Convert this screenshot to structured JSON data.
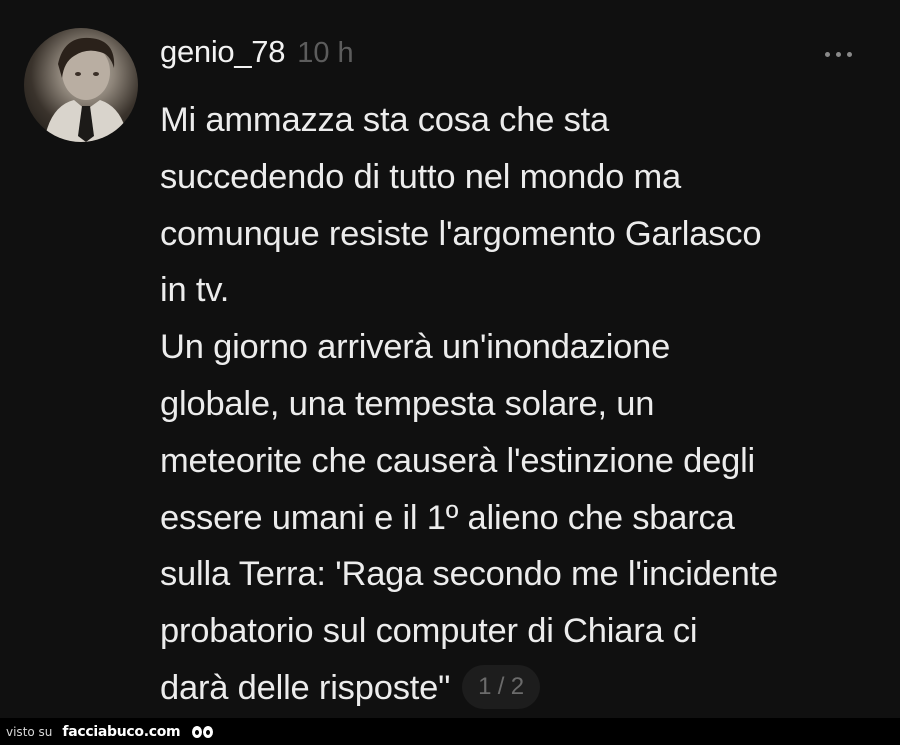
{
  "post": {
    "username": "genio_78",
    "time": "10 h",
    "more_icon": "more-horizontal-icon",
    "text_lines": [
      "Mi ammazza sta cosa che sta",
      "succedendo di tutto nel mondo ma",
      "comunque resiste l'argomento Garlasco",
      "in tv.",
      "Un giorno arriverà un'inondazione",
      "globale, una tempesta solare, un",
      "meteorite che causerà l'estinzione degli",
      "essere umani e il 1º alieno che sbarca",
      "sulla Terra: 'Raga secondo me l'incidente",
      "probatorio sul computer di Chiara ci",
      "darà delle risposte\""
    ],
    "page_indicator": "1 / 2"
  },
  "footer": {
    "prefix": "visto su",
    "brand": "facciabuco.com"
  },
  "colors": {
    "background": "#101010",
    "text": "#ececec",
    "muted": "#5c5c5c"
  }
}
